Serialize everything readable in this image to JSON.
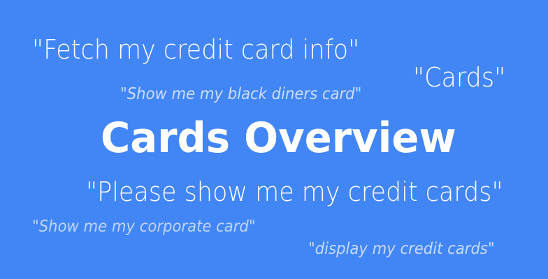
{
  "colors": {
    "background": "#4286f5",
    "text": "#ffffff"
  },
  "title": "Cards Overview",
  "phrases": {
    "fetch": "\"Fetch my credit card info\"",
    "cards": "\"Cards\"",
    "black_diners": "\"Show me my black diners card\"",
    "please_show": "\"Please show me my credit cards\"",
    "corporate": "\"Show me my corporate card\"",
    "display": "\"display my credit cards\""
  }
}
